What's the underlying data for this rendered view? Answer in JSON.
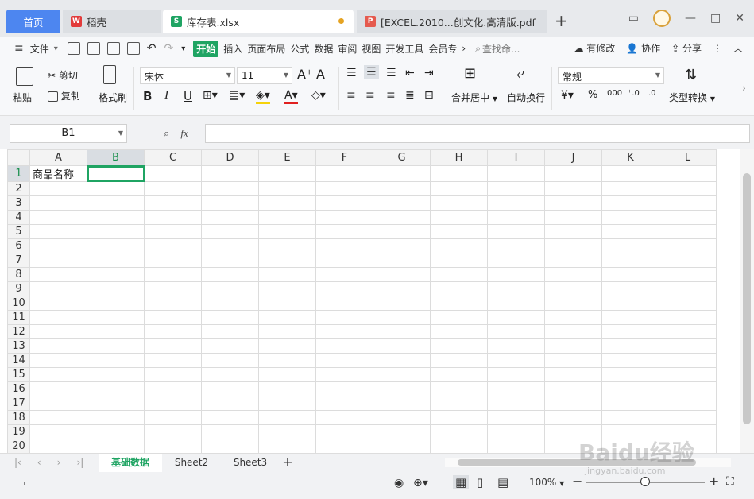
{
  "tabs": {
    "home": "首页",
    "doc": "稻壳",
    "active": "库存表.xlsx",
    "pdf": "[EXCEL.2010...创文化.高清版.pdf"
  },
  "menu": {
    "file": "文件",
    "items": [
      "开始",
      "插入",
      "页面布局",
      "公式",
      "数据",
      "审阅",
      "视图",
      "开发工具",
      "会员专"
    ],
    "search_placeholder": "查找命...",
    "has_changes": "有修改",
    "collaborate": "协作",
    "share": "分享"
  },
  "ribbon": {
    "paste": "粘贴",
    "cut": "剪切",
    "copy": "复制",
    "format_painter": "格式刷",
    "font_name": "宋体",
    "font_size": "11",
    "merge_center": "合并居中",
    "wrap_text": "自动换行",
    "number_format": "常规",
    "type_convert": "类型转换",
    "currency_symbol": "¥",
    "percent_symbol": "%"
  },
  "formula_bar": {
    "cell_ref": "B1",
    "fx": "fx",
    "value": ""
  },
  "grid": {
    "columns": [
      "A",
      "B",
      "C",
      "D",
      "E",
      "F",
      "G",
      "H",
      "I",
      "J",
      "K",
      "L"
    ],
    "row_count": 20,
    "selected_cell": "B1",
    "cells": {
      "A1": "商品名称"
    }
  },
  "sheets": [
    "基础数据",
    "Sheet2",
    "Sheet3"
  ],
  "active_sheet": "基础数据",
  "status": {
    "zoom": "100%"
  },
  "watermark": "Baidu经验",
  "watermark_sub": "jingyan.baidu.com",
  "colors": {
    "accent": "#1fa463",
    "home_tab": "#4d86f0"
  }
}
